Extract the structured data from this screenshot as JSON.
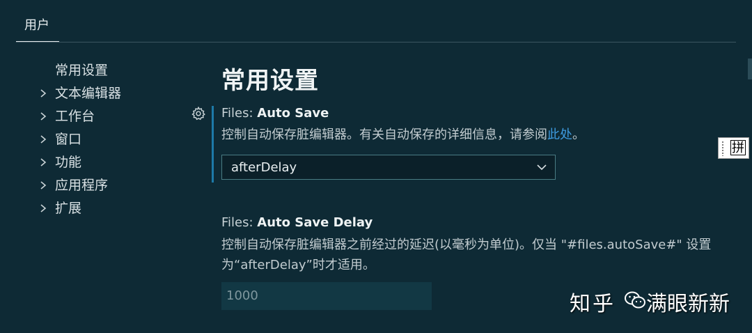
{
  "tabs": [
    {
      "label": "用户",
      "active": true
    }
  ],
  "sidebar": {
    "items": [
      {
        "label": "常用设置",
        "expandable": false
      },
      {
        "label": "文本编辑器",
        "expandable": true
      },
      {
        "label": "工作台",
        "expandable": true
      },
      {
        "label": "窗口",
        "expandable": true
      },
      {
        "label": "功能",
        "expandable": true
      },
      {
        "label": "应用程序",
        "expandable": true
      },
      {
        "label": "扩展",
        "expandable": true
      }
    ]
  },
  "main": {
    "title": "常用设置",
    "settings": [
      {
        "category": "Files: ",
        "key": "Auto Save",
        "description_before_link": "控制自动保存脏编辑器。有关自动保存的详细信息，请参阅",
        "link_text": "此处",
        "description_after_link": "。",
        "value": "afterDelay"
      },
      {
        "category": "Files: ",
        "key": "Auto Save Delay",
        "description_line1": "控制自动保存脏编辑器之前经过的延迟(以毫秒为单位)。仅当 \"#files.autoSave#\" 设置",
        "description_line2": "为“afterDelay”时才适用。",
        "value": "1000"
      }
    ]
  },
  "ime": {
    "label": "拼"
  },
  "watermark": {
    "site": "知乎",
    "author": "满眼新新"
  },
  "icons": {
    "gear": "gear-icon",
    "chevron": "chevron-right-icon",
    "caret": "chevron-down-icon"
  },
  "colors": {
    "background": "#0e2a35",
    "accent": "#1d7aa8",
    "link": "#3e9be0"
  }
}
